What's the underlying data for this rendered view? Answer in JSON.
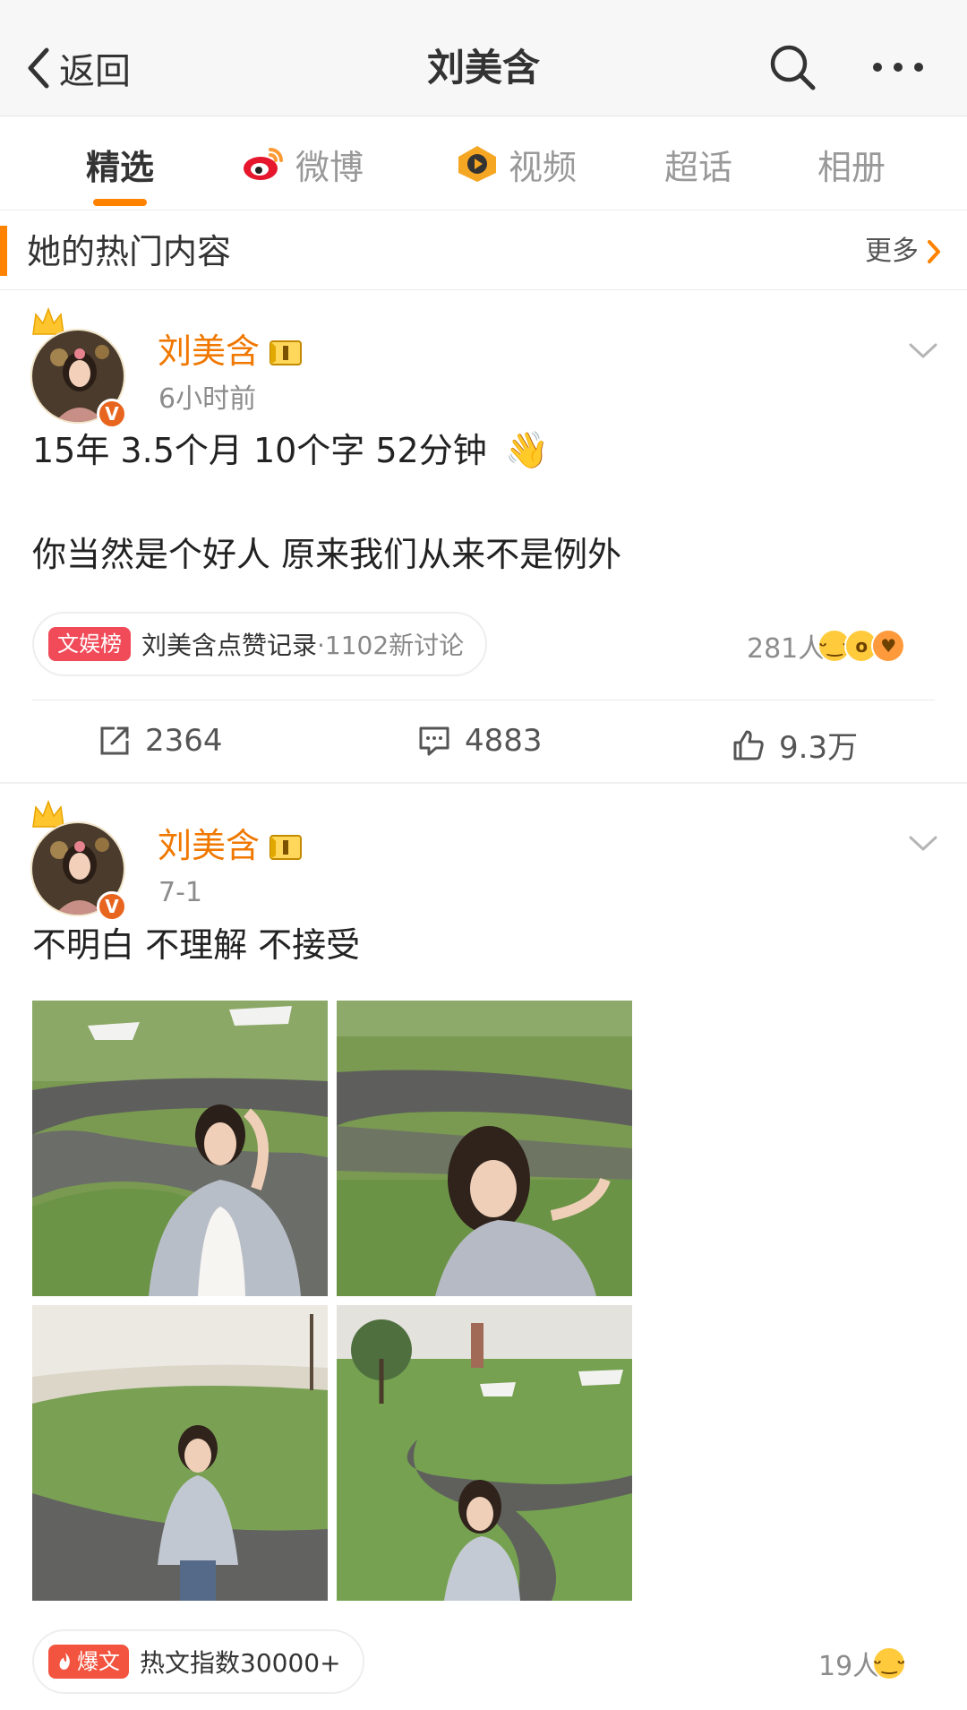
{
  "nav": {
    "back_label": "返回",
    "title": "刘美含"
  },
  "tabs": [
    {
      "label": "精选",
      "icon": ""
    },
    {
      "label": "微博",
      "icon": "weibo-logo-icon"
    },
    {
      "label": "视频",
      "icon": "video-icon"
    },
    {
      "label": "超话",
      "icon": ""
    },
    {
      "label": "相册",
      "icon": ""
    }
  ],
  "section": {
    "title": "她的热门内容",
    "more_label": "更多"
  },
  "posts": [
    {
      "author": "刘美含",
      "time": "6小时前",
      "text_line1": "15年 3.5个月 10个字 52分钟",
      "text_line2": "你当然是个好人   原来我们从来不是例外",
      "emoji": "👋",
      "pill": {
        "tag": "文娱榜",
        "text": "刘美含点赞记录",
        "sub": "·1102新讨论"
      },
      "reactions": "281人",
      "actions": {
        "repost": "2364",
        "comment": "4883",
        "like": "9.3万"
      }
    },
    {
      "author": "刘美含",
      "time": "7-1",
      "text_line1": "不明白 不理解 不接受",
      "pill": {
        "tag": "爆文",
        "text": "热文指数30000+"
      },
      "reactions": "19人"
    }
  ],
  "colors": {
    "accent": "#ff8200",
    "username": "#f07800",
    "tag_red": "#f14a58"
  }
}
